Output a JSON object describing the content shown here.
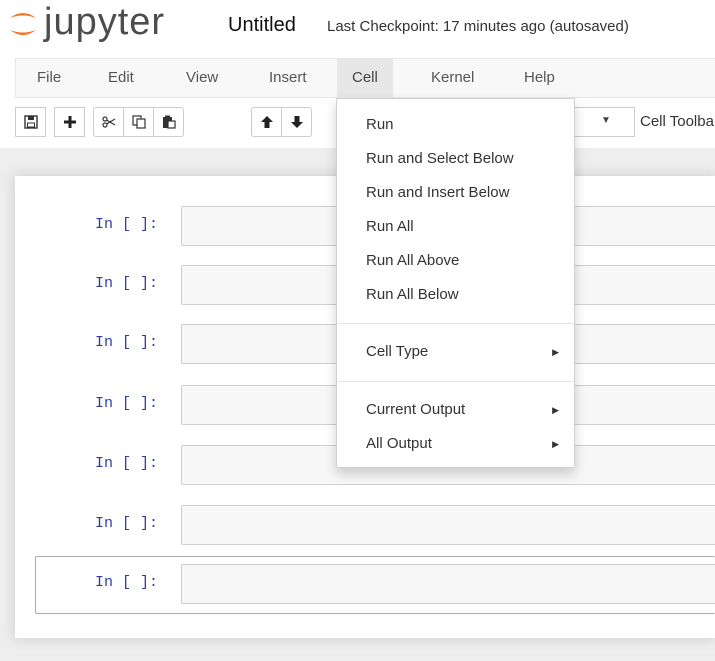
{
  "header": {
    "logo_text": "jupyter",
    "notebook_name": "Untitled",
    "checkpoint_status": "Last Checkpoint: 17 minutes ago (autosaved)"
  },
  "menubar": {
    "items": [
      "File",
      "Edit",
      "View",
      "Insert",
      "Cell",
      "Kernel",
      "Help"
    ],
    "active": "Cell"
  },
  "toolbar": {
    "buttons": [
      "save-icon",
      "plus-icon",
      "scissors-icon",
      "copy-icon",
      "paste-icon",
      "arrow-up-icon",
      "arrow-down-icon"
    ],
    "celltype_caret": "▼",
    "celltoolbar_label": "Cell Toolbar"
  },
  "cells": [
    {
      "prompt": "In [ ]:"
    },
    {
      "prompt": "In [ ]:"
    },
    {
      "prompt": "In [ ]:"
    },
    {
      "prompt": "In [ ]:"
    },
    {
      "prompt": "In [ ]:"
    },
    {
      "prompt": "In [ ]:"
    },
    {
      "prompt": "In [ ]:"
    }
  ],
  "selected_cell_index": 6,
  "cell_menu": {
    "group1": [
      "Run",
      "Run and Select Below",
      "Run and Insert Below",
      "Run All",
      "Run All Above",
      "Run All Below"
    ],
    "group2": [
      "Cell Type"
    ],
    "group3": [
      "Current Output",
      "All Output"
    ],
    "submenu_arrow": "▶"
  },
  "colors": {
    "brand_orange": "#f37726",
    "prompt_blue": "#303f9f"
  }
}
